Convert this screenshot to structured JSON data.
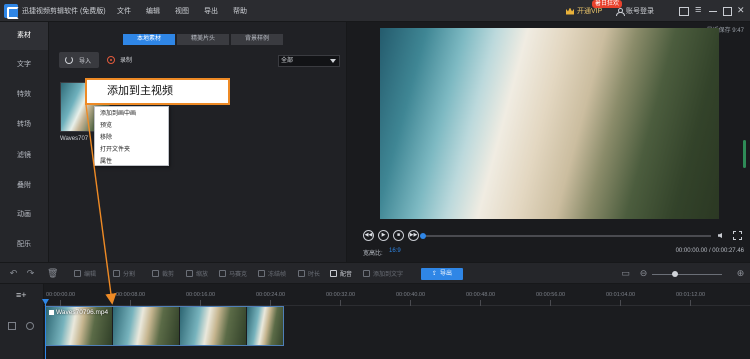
{
  "app": {
    "title": "迅捷视频剪辑软件 (免费版)",
    "menus": [
      "文件",
      "编辑",
      "视图",
      "导出",
      "帮助"
    ],
    "vip_label": "开通VIP",
    "vip_badge": "暑日狂欢",
    "login_label": "账号登录"
  },
  "sidebar": {
    "items": [
      {
        "label": "素材",
        "active": true
      },
      {
        "label": "文字"
      },
      {
        "label": "特效"
      },
      {
        "label": "转场"
      },
      {
        "label": "滤镜"
      },
      {
        "label": "叠附"
      },
      {
        "label": "动画"
      },
      {
        "label": "配乐"
      }
    ]
  },
  "media": {
    "tabs": [
      {
        "label": "本地素材",
        "active": true
      },
      {
        "label": "精美片头"
      },
      {
        "label": "背景样例"
      }
    ],
    "import_label": "导入",
    "record_label": "录制",
    "filter_value": "全部",
    "thumbnail_name": "Waves70796.mp4",
    "thumbnail_label_visible": "Waves707",
    "context_menu": [
      "添加到主视频",
      "添加到画中画",
      "预览",
      "移除",
      "打开文件夹",
      "属性"
    ],
    "callout_text": "添加到主视频"
  },
  "preview": {
    "autosave": "最近保存 9:47",
    "ratio_label": "宽高比:",
    "ratio_value": "16:9",
    "timecode": "00:00:00.00 / 00:00:27.46",
    "progress": 0.0,
    "icons": [
      "rewind-icon",
      "play-icon",
      "stop-icon",
      "forward-icon"
    ]
  },
  "toolbar": {
    "tools": [
      "编辑",
      "分割",
      "裁剪",
      "缩放",
      "马赛克",
      "冻结帧",
      "时长",
      "配音",
      "添加到文字"
    ],
    "export_label": "导出"
  },
  "timeline": {
    "ticks": [
      "00:00:00.00",
      "00:00:08.00",
      "00:00:16.00",
      "00:00:24.00",
      "00:00:32.00",
      "00:00:40.00",
      "00:00:48.00",
      "00:00:56.00",
      "00:01:04.00",
      "00:01:12.00"
    ],
    "clip_name": "Waves70796.mp4"
  },
  "colors": {
    "accent": "#2f86e6",
    "callout_border": "#ee8a25",
    "background": "#1e1f22"
  }
}
